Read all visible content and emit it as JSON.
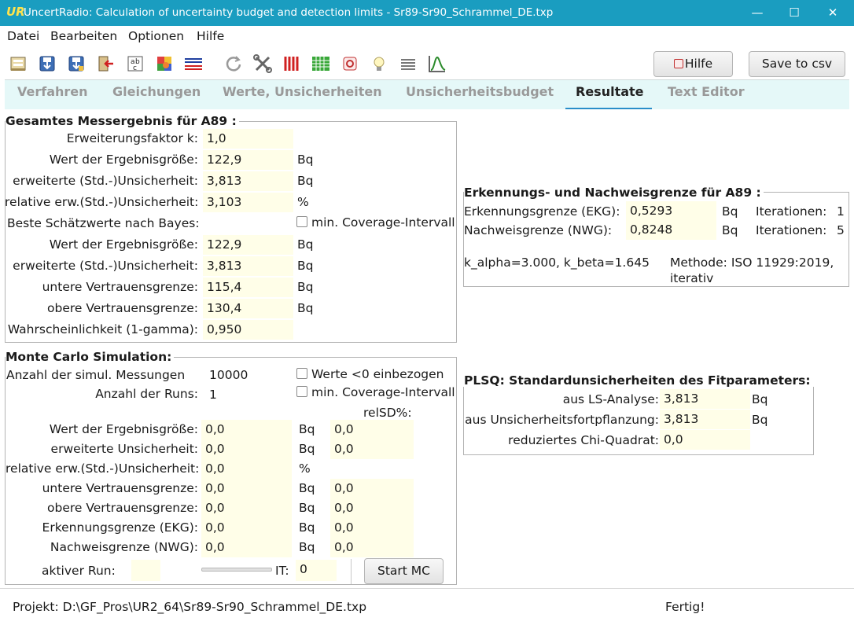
{
  "window": {
    "app_icon": "UR",
    "title": "UncertRadio: Calculation of uncertainty budget and detection limits    -    Sr89-Sr90_Schrammel_DE.txp",
    "minimize": "—",
    "maximize": "☐",
    "close": "✕"
  },
  "menu": [
    "Datei",
    "Bearbeiten",
    "Optionen",
    "Hilfe"
  ],
  "toolbar": {
    "icons": [
      "open-file-icon",
      "save-icon",
      "save-as-icon",
      "exit-icon",
      "text-font-icon",
      "color-palette-icon",
      "lines-arrow-icon",
      "reload-icon",
      "tools-icon",
      "bar-chart-icon",
      "grid-table-icon",
      "target-icon",
      "lightbulb-icon",
      "list-icon",
      "curve-plot-icon"
    ],
    "help_label": "Hilfe",
    "save_csv_label": "Save to csv"
  },
  "tabs": [
    {
      "label": "Verfahren"
    },
    {
      "label": "Gleichungen"
    },
    {
      "label": "Werte, Unsicherheiten"
    },
    {
      "label": "Unsicherheitsbudget"
    },
    {
      "label": "Resultate"
    },
    {
      "label": "Text Editor"
    }
  ],
  "gesamt": {
    "title": "Gesamtes Messergebnis für A89 :",
    "k_label": "Erweiterungsfaktor k:",
    "k_value": "1,0",
    "wert_label": "Wert der Ergebnisgröße:",
    "wert_value": "122,9",
    "wert_unit": "Bq",
    "erw_label": "erweiterte (Std.-)Unsicherheit:",
    "erw_value": "3,813",
    "erw_unit": "Bq",
    "rel_label": "relative erw.(Std.-)Unsicherheit:",
    "rel_value": "3,103",
    "rel_unit": "%",
    "bayes_label": "Beste Schätzwerte nach Bayes:",
    "bayes_check": "min. Coverage-Intervall",
    "b_wert_label": "Wert der Ergebnisgröße:",
    "b_wert_value": "122,9",
    "b_wert_unit": "Bq",
    "b_erw_label": "erweiterte (Std.-)Unsicherheit:",
    "b_erw_value": "3,813",
    "b_erw_unit": "Bq",
    "untere_label": "untere Vertrauensgrenze:",
    "untere_value": "115,4",
    "untere_unit": "Bq",
    "obere_label": "obere Vertrauensgrenze:",
    "obere_value": "130,4",
    "obere_unit": "Bq",
    "wahr_label": "Wahrscheinlichkeit (1-gamma):",
    "wahr_value": "0,950"
  },
  "mc": {
    "title": "Monte Carlo Simulation:",
    "anzahl_label": "Anzahl der simul. Messungen",
    "anzahl_value": "10000",
    "werte_check": "Werte <0 einbezogen",
    "runs_label": "Anzahl der Runs:",
    "runs_value": "1",
    "coverage_check": "min. Coverage-Intervall",
    "relsd_label": "relSD%:",
    "rows": [
      {
        "label": "Wert der Ergebnisgröße:",
        "value": "0,0",
        "unit": "Bq",
        "relsd": "0,0"
      },
      {
        "label": "erweiterte Unsicherheit:",
        "value": "0,0",
        "unit": "Bq",
        "relsd": "0,0"
      },
      {
        "label": "relative erw.(Std.-)Unsicherheit:",
        "value": "0,0",
        "unit": "%",
        "relsd": ""
      },
      {
        "label": "untere Vertrauensgrenze:",
        "value": "0,0",
        "unit": "Bq",
        "relsd": "0,0"
      },
      {
        "label": "obere Vertrauensgrenze:",
        "value": "0,0",
        "unit": "Bq",
        "relsd": "0,0"
      },
      {
        "label": "Erkennungsgrenze (EKG):",
        "value": "0,0",
        "unit": "Bq",
        "relsd": "0,0"
      },
      {
        "label": "Nachweisgrenze (NWG):",
        "value": "0,0",
        "unit": "Bq",
        "relsd": "0,0"
      }
    ],
    "aktiver_run_label": "aktiver Run:",
    "aktiver_run_value": "",
    "it_label": "IT:",
    "it_value": "0",
    "start_label": "Start MC"
  },
  "detection": {
    "title": "Erkennungs- und Nachweisgrenze für A89 :",
    "ekg_label": "Erkennungsgrenze (EKG):",
    "ekg_value": "0,5293",
    "ekg_unit": "Bq",
    "ekg_iter_label": "Iterationen:",
    "ekg_iter_value": "1",
    "nwg_label": "Nachweisgrenze (NWG):",
    "nwg_value": "0,8248",
    "nwg_unit": "Bq",
    "nwg_iter_label": "Iterationen:",
    "nwg_iter_value": "5",
    "kparams": "k_alpha=3.000,  k_beta=1.645",
    "methode_line1": "Methode: ISO 11929:2019,",
    "methode_line2": "iterativ"
  },
  "plsq": {
    "title": "PLSQ: Standardunsicherheiten des Fitparameters:",
    "ls_label": "aus LS-Analyse:",
    "ls_value": "3,813",
    "ls_unit": "Bq",
    "fort_label": "aus Unsicherheitsfortpflanzung:",
    "fort_value": "3,813",
    "fort_unit": "Bq",
    "chi_label": "reduziertes Chi-Quadrat:",
    "chi_value": "0,0"
  },
  "status": {
    "project": "Projekt: D:\\GF_Pros\\UR2_64\\Sr89-Sr90_Schrammel_DE.txp",
    "state": "Fertig!"
  }
}
